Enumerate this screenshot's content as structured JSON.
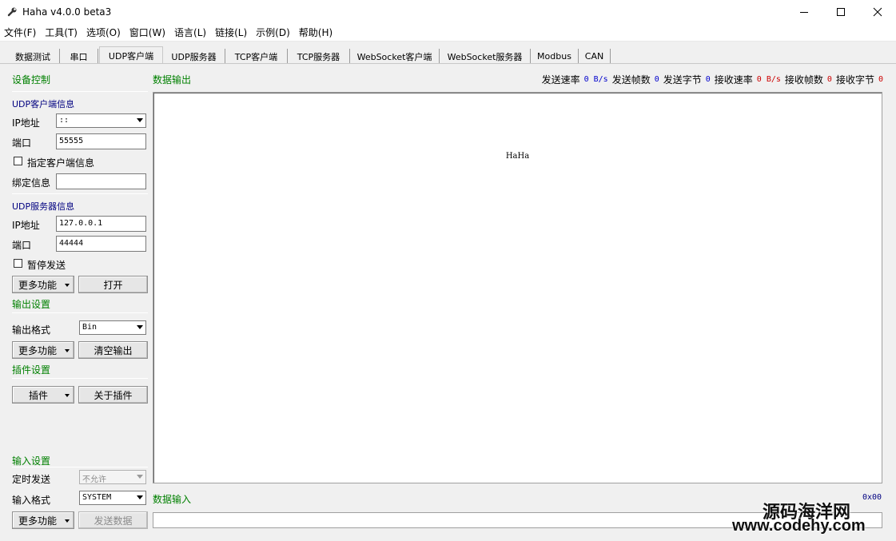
{
  "window": {
    "title": "Haha v4.0.0 beta3"
  },
  "menu": [
    "文件(F)",
    "工具(T)",
    "选项(O)",
    "窗口(W)",
    "语言(L)",
    "链接(L)",
    "示例(D)",
    "帮助(H)"
  ],
  "tabs": [
    "数据测试",
    "串口",
    "UDP客户端",
    "UDP服务器",
    "TCP客户端",
    "TCP服务器",
    "WebSocket客户端",
    "WebSocket服务器",
    "Modbus",
    "CAN"
  ],
  "device_control": {
    "title": "设备控制",
    "client_info": {
      "title": "UDP客户端信息",
      "ip_label": "IP地址",
      "ip_value": "::",
      "port_label": "端口",
      "port_value": "55555",
      "specify_label": "指定客户端信息",
      "bind_label": "绑定信息",
      "bind_value": ""
    },
    "server_info": {
      "title": "UDP服务器信息",
      "ip_label": "IP地址",
      "ip_value": "127.0.0.1",
      "port_label": "端口",
      "port_value": "44444",
      "pause_label": "暂停发送"
    },
    "more_label": "更多功能",
    "open_label": "打开"
  },
  "output_settings": {
    "title": "输出设置",
    "format_label": "输出格式",
    "format_value": "Bin",
    "more_label": "更多功能",
    "clear_label": "清空输出"
  },
  "plugin_settings": {
    "title": "插件设置",
    "plugin_label": "插件",
    "about_label": "关于插件"
  },
  "input_settings": {
    "title": "输入设置",
    "timer_label": "定时发送",
    "timer_value": "不允许",
    "format_label": "输入格式",
    "format_value": "SYSTEM",
    "more_label": "更多功能",
    "send_label": "发送数据"
  },
  "output": {
    "title": "数据输出",
    "content": "HaHa"
  },
  "input": {
    "title": "数据输入",
    "hex_value": "0x00"
  },
  "stats": {
    "send_rate_label": "发送速率",
    "send_rate_value": "0 B/s",
    "send_frames_label": "发送帧数",
    "send_frames_value": "0",
    "send_bytes_label": "发送字节",
    "send_bytes_value": "0",
    "recv_rate_label": "接收速率",
    "recv_rate_value": "0 B/s",
    "recv_frames_label": "接收帧数",
    "recv_frames_value": "0",
    "recv_bytes_label": "接收字节",
    "recv_bytes_value": "0"
  },
  "watermark": {
    "line1": "源码海洋网",
    "line2": "www.codehy.com"
  },
  "colors": {
    "section": "#008000",
    "group": "#000080",
    "stat_send": "#0000cc",
    "stat_recv": "#cc0000"
  }
}
